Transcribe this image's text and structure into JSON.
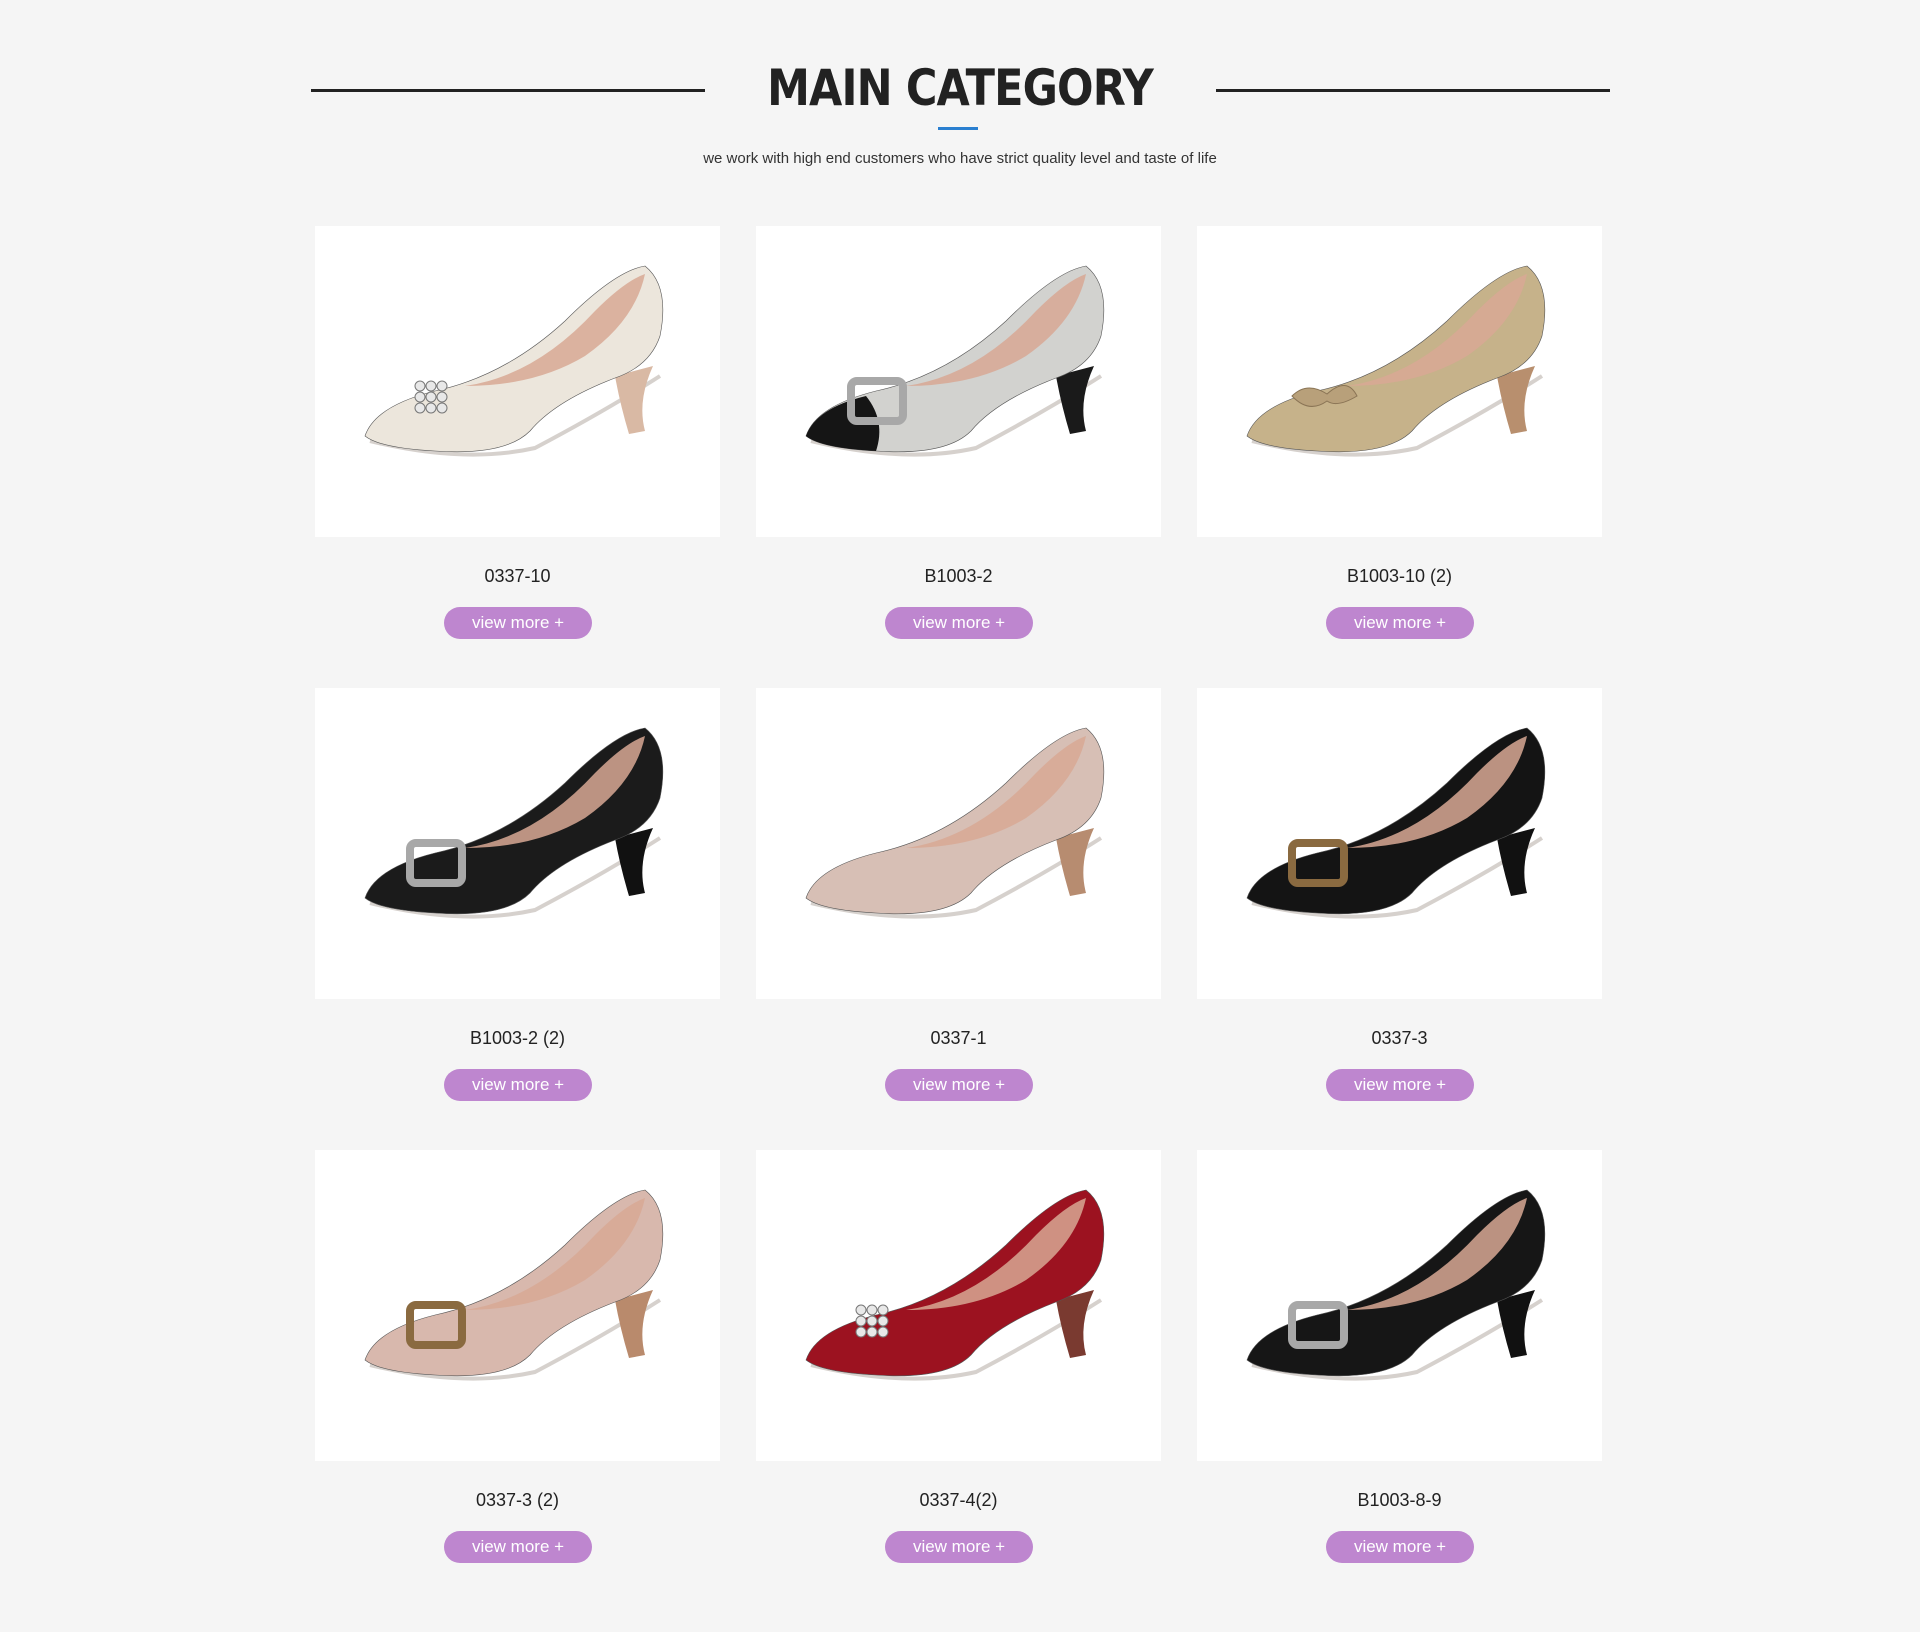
{
  "header": {
    "title": "MAIN CATEGORY",
    "subtitle": "we work with high end customers who have strict quality level and taste of life"
  },
  "products": [
    {
      "name": "0337-10",
      "button": "view more +",
      "upper": "#ece6dc",
      "toe": "#ece6dc",
      "heel": "#d9b9a4",
      "ornament": "crystal"
    },
    {
      "name": "B1003-2",
      "button": "view more +",
      "upper": "#d2d2cf",
      "toe": "#151515",
      "heel": "#1a1a1a",
      "ornament": "buckle-silver"
    },
    {
      "name": "B1003-10 (2)",
      "button": "view more +",
      "upper": "#c6b28a",
      "toe": "#c6b28a",
      "heel": "#b88f6e",
      "ornament": "bow"
    },
    {
      "name": "B1003-2 (2)",
      "button": "view more +",
      "upper": "#1b1b1b",
      "toe": "#1b1b1b",
      "heel": "#111111",
      "ornament": "buckle-silver"
    },
    {
      "name": "0337-1",
      "button": "view more +",
      "upper": "#d7bfb5",
      "toe": "#d7bfb5",
      "heel": "#b78c70",
      "ornament": "none"
    },
    {
      "name": "0337-3",
      "button": "view more +",
      "upper": "#141414",
      "toe": "#141414",
      "heel": "#111111",
      "ornament": "buckle-bronze"
    },
    {
      "name": "0337-3 (2)",
      "button": "view more +",
      "upper": "#d8b8ad",
      "toe": "#d8b8ad",
      "heel": "#b98a6c",
      "ornament": "buckle-bronze"
    },
    {
      "name": "0337-4(2)",
      "button": "view more +",
      "upper": "#9c1220",
      "toe": "#9c1220",
      "heel": "#7a3a30",
      "ornament": "crystal"
    },
    {
      "name": "B1003-8-9",
      "button": "view more +",
      "upper": "#161616",
      "toe": "#161616",
      "heel": "#111111",
      "ornament": "buckle-silver"
    }
  ]
}
